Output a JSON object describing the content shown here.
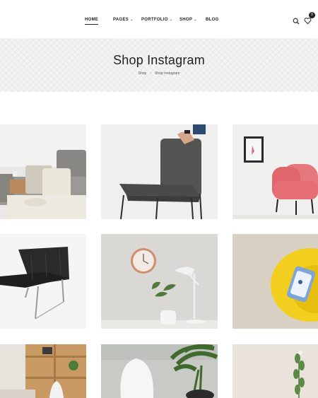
{
  "nav": {
    "home": "HOME",
    "pages": "PAGES",
    "portfolio": "PORTFOLIO",
    "shop": "SHOP",
    "blog": "BLOG"
  },
  "header": {
    "wishlist_count": "0"
  },
  "page": {
    "title": "Shop Instagram",
    "breadcrumb": [
      "Shop",
      "Shop Instagram"
    ]
  },
  "icons": {
    "search": "search-icon",
    "wishlist": "heart-icon",
    "dropdown": "chevron-down-icon"
  },
  "colors": {
    "accent": "#222222",
    "band": "#f4f4f4",
    "pink_chair": "#e5787c",
    "yellow_chair": "#f2cf1e"
  }
}
